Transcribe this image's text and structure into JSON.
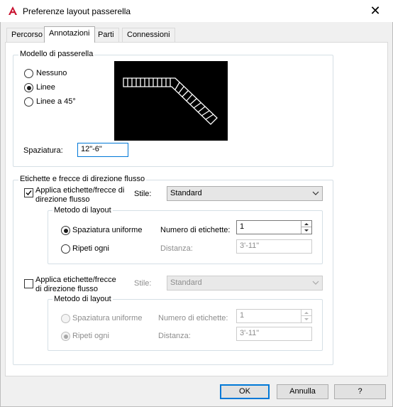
{
  "window": {
    "title": "Preferenze layout passerella",
    "close_glyph": "✕"
  },
  "tabs": [
    {
      "label": "Percorso"
    },
    {
      "label": "Annotazioni",
      "active": true
    },
    {
      "label": "Parti"
    },
    {
      "label": "Connessioni"
    }
  ],
  "model_group": {
    "title": "Modello di passerella",
    "options": [
      {
        "label": "Nessuno",
        "checked": false
      },
      {
        "label": "Linee",
        "checked": true
      },
      {
        "label": "Linee a 45°",
        "checked": false
      }
    ],
    "spacing_label": "Spaziatura:",
    "spacing_value": "12\"-6\""
  },
  "labels_group": {
    "title": "Etichette e frecce di direzione flusso",
    "section1": {
      "checkbox_label_line1": "Applica etichette/frecce di",
      "checkbox_label_line2": "direzione flusso",
      "checked": true,
      "style_label": "Stile:",
      "style_value": "Standard",
      "layout": {
        "title": "Metodo di layout",
        "uniform_label": "Spaziatura uniforme",
        "uniform_checked": true,
        "count_label": "Numero di etichette:",
        "count_value": "1",
        "repeat_label": "Ripeti ogni",
        "repeat_checked": false,
        "distance_label": "Distanza:",
        "distance_value": "3'-11\""
      }
    },
    "section2": {
      "checkbox_label_line1": "Applica etichette/frecce",
      "checkbox_label_line2": "di direzione flusso",
      "checked": false,
      "style_label": "Stile:",
      "style_value": "Standard",
      "layout": {
        "title": "Metodo di layout",
        "uniform_label": "Spaziatura uniforme",
        "uniform_checked": false,
        "count_label": "Numero di etichette:",
        "count_value": "1",
        "repeat_label": "Ripeti ogni",
        "repeat_checked": true,
        "distance_label": "Distanza:",
        "distance_value": "3'-11\""
      }
    }
  },
  "buttons": {
    "ok": "OK",
    "cancel": "Annulla",
    "help": "?"
  },
  "colors": {
    "accent": "#0078d7",
    "app_icon": "#c8102e",
    "preview_bg": "#000000"
  }
}
